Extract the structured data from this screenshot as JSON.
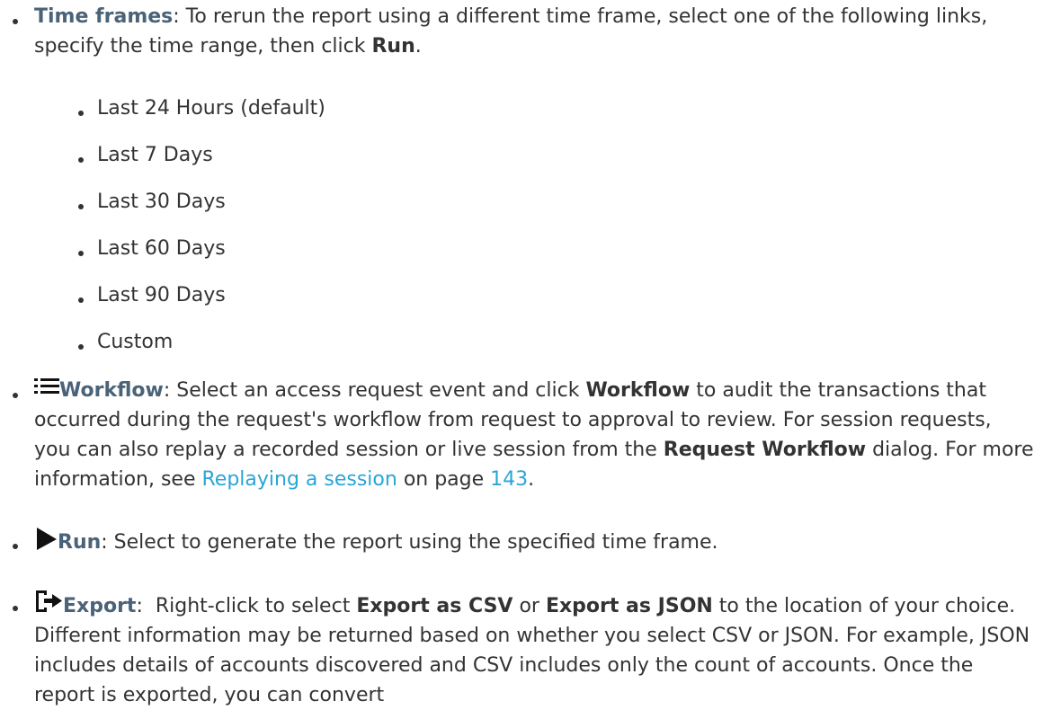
{
  "time_frames": {
    "term": "Time frames",
    "text_before_run": ": To rerun the report using a different time frame, select one of the following links, specify the time range, then click ",
    "run_label": "Run",
    "text_after_run": ".",
    "options": [
      "Last 24 Hours (default)",
      "Last 7 Days",
      "Last 30 Days",
      "Last 60 Days",
      "Last 90 Days",
      "Custom"
    ]
  },
  "workflow": {
    "icon": "list-icon",
    "term": "Workflow",
    "text_1": ": Select an access request event and click ",
    "button_label": "Workflow",
    "text_2": " to audit the transactions that occurred during the request's workflow from request to approval to review. For session requests, you can also replay a recorded session or live session from the ",
    "dialog_label": "Request Workflow",
    "text_3": " dialog. For more information, see ",
    "link_text": "Replaying a session",
    "text_4": " on page ",
    "page_link": "143",
    "text_5": "."
  },
  "run": {
    "icon": "play-icon",
    "term": "Run",
    "text": ": Select to generate the report using the specified time frame."
  },
  "export": {
    "icon": "export-icon",
    "term": "Export",
    "text_1": ":  Right-click to select ",
    "csv_label": "Export as CSV",
    "text_2": " or ",
    "json_label": "Export as JSON",
    "text_3": " to the location of your choice. Different information may be returned based on whether you select CSV or JSON. For example, JSON includes details of accounts discovered and CSV includes only the count of accounts. Once the report is exported, you can convert"
  }
}
